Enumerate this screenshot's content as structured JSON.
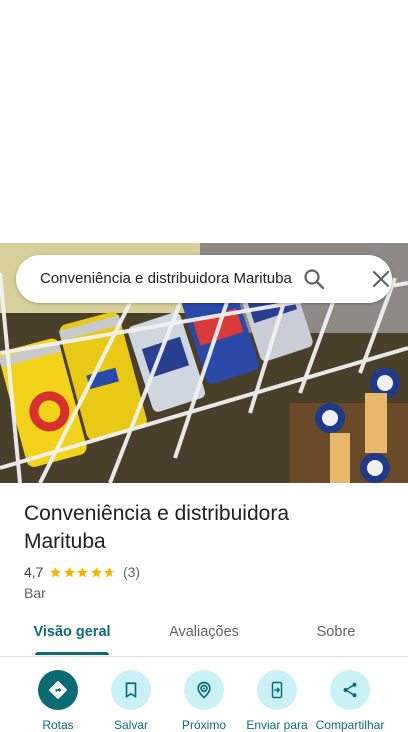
{
  "search": {
    "query": "Conveniência e distribuidora Marituba"
  },
  "place": {
    "title": "Conveniência e distribuidora Marituba",
    "rating": "4,7",
    "rating_count": "(3)",
    "category": "Bar",
    "star_fill": 4.7
  },
  "tabs": [
    {
      "label": "Visão geral",
      "active": true
    },
    {
      "label": "Avaliações",
      "active": false
    },
    {
      "label": "Sobre",
      "active": false
    }
  ],
  "actions": [
    {
      "label": "Rotas",
      "icon": "directions-icon"
    },
    {
      "label": "Salvar",
      "icon": "bookmark-icon"
    },
    {
      "label": "Próximo",
      "icon": "nearby-icon"
    },
    {
      "label": "Enviar para",
      "icon": "send-to-phone-icon"
    },
    {
      "label": "Compartilhar",
      "icon": "share-icon"
    }
  ],
  "colors": {
    "accent": "#0b6b73",
    "action_bg": "#c9f1f7",
    "star": "#f4b400"
  }
}
